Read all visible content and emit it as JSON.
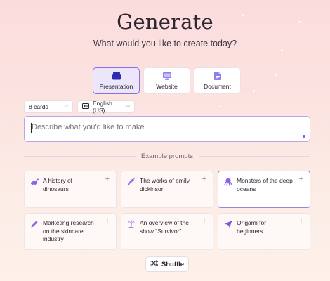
{
  "header": {
    "title": "Generate",
    "subtitle": "What would you like to create today?"
  },
  "modes": [
    {
      "label": "Presentation",
      "icon": "presentation-icon",
      "active": true
    },
    {
      "label": "Website",
      "icon": "website-icon",
      "active": false
    },
    {
      "label": "Document",
      "icon": "document-icon",
      "active": false
    }
  ],
  "controls": {
    "cards_select": "8 cards",
    "language_select": "English (US)"
  },
  "prompt": {
    "placeholder": "Describe what you'd like to make",
    "value": ""
  },
  "examples": {
    "heading": "Example prompts",
    "items": [
      {
        "text": "A history of dinosaurs",
        "icon": "dinosaur-icon"
      },
      {
        "text": "The works of emily dickinson",
        "icon": "quill-icon"
      },
      {
        "text": "Monsters of the deep oceans",
        "icon": "octopus-icon"
      },
      {
        "text": "Marketing research on the skincare industry",
        "icon": "pencil-icon"
      },
      {
        "text": "An overview of the show \"Survivor\"",
        "icon": "palm-tree-icon"
      },
      {
        "text": "Origami for beginners",
        "icon": "paper-plane-icon"
      }
    ],
    "add_glyph": "+"
  },
  "shuffle": {
    "label": "Shuffle",
    "icon": "shuffle-icon"
  },
  "colors": {
    "accent": "#7a5be8",
    "icon_purple": "#8a63e6",
    "background_top": "#fbdcdc",
    "background_bottom": "#fdf1ea"
  }
}
